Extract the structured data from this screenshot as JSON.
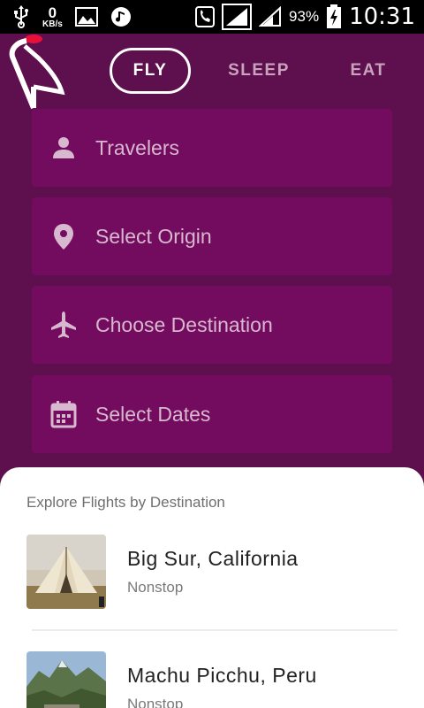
{
  "status_bar": {
    "data_speed_value": "0",
    "data_speed_unit": "KB/s",
    "battery_percent": "93%",
    "time": "10:31",
    "icons": [
      "usb-icon",
      "image-icon",
      "music-icon",
      "call-icon",
      "signal-icon",
      "signal-icon",
      "battery-charging-icon"
    ]
  },
  "header": {
    "logo_icon": "bird-logo-icon",
    "tabs": [
      {
        "label": "FLY",
        "active": true
      },
      {
        "label": "SLEEP",
        "active": false
      },
      {
        "label": "EAT",
        "active": false
      }
    ]
  },
  "form": {
    "fields": [
      {
        "label": "Travelers",
        "icon": "person-icon"
      },
      {
        "label": "Select Origin",
        "icon": "location-pin-icon"
      },
      {
        "label": "Choose Destination",
        "icon": "airplane-icon"
      },
      {
        "label": "Select Dates",
        "icon": "calendar-icon"
      }
    ]
  },
  "explore": {
    "title": "Explore Flights by Destination",
    "destinations": [
      {
        "name": "Big Sur, California",
        "subtitle": "Nonstop",
        "thumbnail": "tent-photo"
      },
      {
        "name": "Machu Picchu, Peru",
        "subtitle": "Nonstop",
        "thumbnail": "mountain-ruins-photo"
      }
    ]
  },
  "colors": {
    "background": "#5e0f4d",
    "field": "#730b5e",
    "field_text": "#d8b8cf",
    "tab_inactive": "#c9a3bd",
    "logo_accent": "#e8103a"
  }
}
